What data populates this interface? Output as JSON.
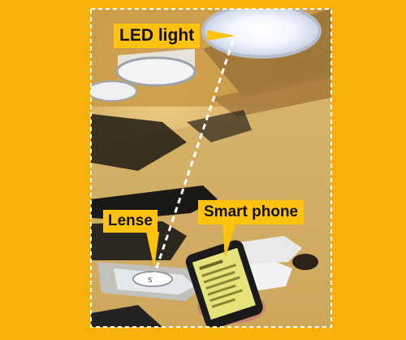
{
  "labels": {
    "led_light": "LED light",
    "lense": "Lense",
    "smart_phone": "Smart phone"
  },
  "colors": {
    "background": "#F7B10A",
    "callout": "#FFC20E",
    "callout_text": "#111111",
    "frame_dash": "#FFFFFF"
  }
}
